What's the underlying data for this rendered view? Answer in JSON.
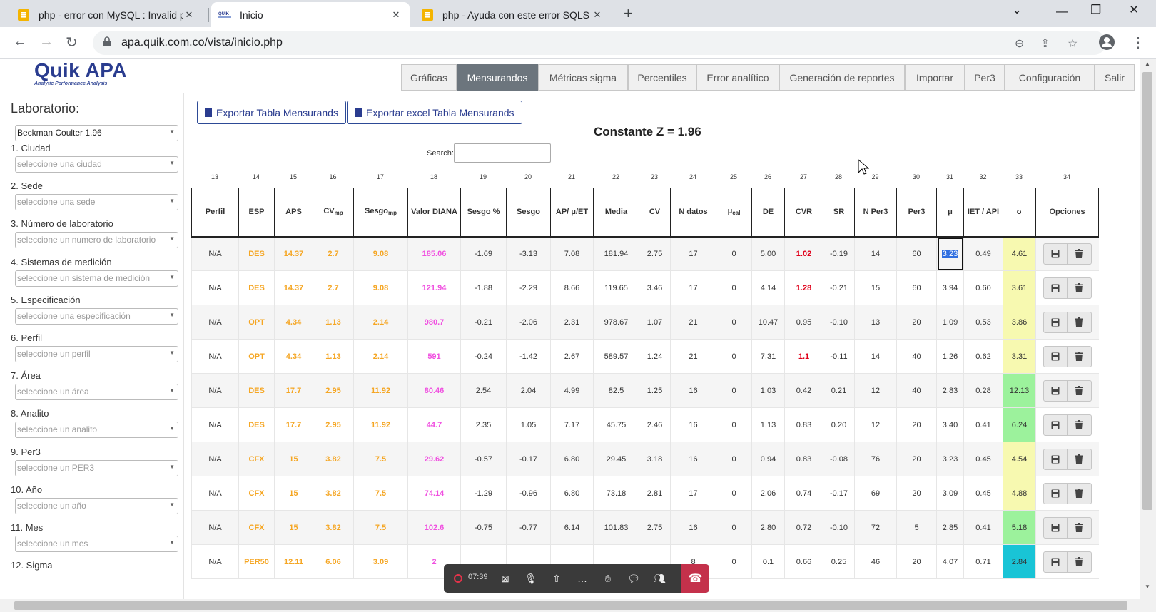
{
  "browser": {
    "tabs": [
      {
        "title": "php - error con MySQL : Invalid p",
        "active": false
      },
      {
        "title": "Inicio",
        "active": true
      },
      {
        "title": "php - Ayuda con este error SQLS",
        "active": false
      }
    ],
    "url": "apa.quik.com.co/vista/inicio.php"
  },
  "app": {
    "logo": "Quik APA",
    "logo_sub": "Analytic Performance Analysis",
    "nav": [
      "Gráficas",
      "Mensurandos",
      "Métricas sigma",
      "Percentiles",
      "Error analítico",
      "Generación de reportes",
      "Importar",
      "Per3",
      "Configuración",
      "Salir"
    ],
    "active_nav": "Mensurandos"
  },
  "sidebar": {
    "title": "Laboratorio:",
    "lab_value": "Beckman Coulter 1.96",
    "filters": [
      {
        "label": "1. Ciudad",
        "placeholder": "seleccione una ciudad"
      },
      {
        "label": "2. Sede",
        "placeholder": "seleccione una sede"
      },
      {
        "label": "3. Número de laboratorio",
        "placeholder": "seleccione un numero de laboratorio"
      },
      {
        "label": "4. Sistemas de medición",
        "placeholder": "seleccione un sistema de medición"
      },
      {
        "label": "5. Especificación",
        "placeholder": "seleccione una especificación"
      },
      {
        "label": "6. Perfil",
        "placeholder": "seleccione un perfil"
      },
      {
        "label": "7. Área",
        "placeholder": "seleccione un área"
      },
      {
        "label": "8. Analito",
        "placeholder": "seleccione un analito"
      },
      {
        "label": "9. Per3",
        "placeholder": "seleccione un PER3"
      },
      {
        "label": "10. Año",
        "placeholder": "seleccione un año"
      },
      {
        "label": "11. Mes",
        "placeholder": "seleccione un mes"
      },
      {
        "label": "12. Sigma",
        "placeholder": ""
      }
    ]
  },
  "main": {
    "export_pdf": "Exportar Tabla Mensurands",
    "export_excel": "Exportar excel Tabla Mensurands",
    "constant": "Constante Z = 1.96",
    "search_label": "Search:",
    "column_numbers": [
      "13",
      "14",
      "15",
      "16",
      "17",
      "18",
      "19",
      "20",
      "21",
      "22",
      "23",
      "24",
      "25",
      "26",
      "27",
      "28",
      "29",
      "30",
      "31",
      "32",
      "33",
      "34"
    ],
    "headers": [
      "Perfil",
      "ESP",
      "APS",
      "CV",
      "Sesgo",
      "Valor DIANA",
      "Sesgo %",
      "Sesgo",
      "AP/ μ/ET",
      "Media",
      "CV",
      "N datos",
      "μ",
      "DE",
      "CVR",
      "SR",
      "N Per3",
      "Per3",
      "μ",
      "IET / API",
      "σ",
      "Opciones"
    ],
    "header_subs": {
      "CV_mp": "mp",
      "Sesgo_mp": "mp",
      "mu_cal": "cal"
    },
    "rows": [
      [
        "N/A",
        "DES",
        "14.37",
        "2.7",
        "9.08",
        "185.06",
        "-1.69",
        "-3.13",
        "7.08",
        "181.94",
        "2.75",
        "17",
        "0",
        "5.00",
        "1.02",
        "-0.19",
        "14",
        "60",
        "3.23",
        "0.49",
        "4.61"
      ],
      [
        "N/A",
        "DES",
        "14.37",
        "2.7",
        "9.08",
        "121.94",
        "-1.88",
        "-2.29",
        "8.66",
        "119.65",
        "3.46",
        "17",
        "0",
        "4.14",
        "1.28",
        "-0.21",
        "15",
        "60",
        "3.94",
        "0.60",
        "3.61"
      ],
      [
        "N/A",
        "OPT",
        "4.34",
        "1.13",
        "2.14",
        "980.7",
        "-0.21",
        "-2.06",
        "2.31",
        "978.67",
        "1.07",
        "21",
        "0",
        "10.47",
        "0.95",
        "-0.10",
        "13",
        "20",
        "1.09",
        "0.53",
        "3.86"
      ],
      [
        "N/A",
        "OPT",
        "4.34",
        "1.13",
        "2.14",
        "591",
        "-0.24",
        "-1.42",
        "2.67",
        "589.57",
        "1.24",
        "21",
        "0",
        "7.31",
        "1.1",
        "-0.11",
        "14",
        "40",
        "1.26",
        "0.62",
        "3.31"
      ],
      [
        "N/A",
        "DES",
        "17.7",
        "2.95",
        "11.92",
        "80.46",
        "2.54",
        "2.04",
        "4.99",
        "82.5",
        "1.25",
        "16",
        "0",
        "1.03",
        "0.42",
        "0.21",
        "12",
        "40",
        "2.83",
        "0.28",
        "12.13"
      ],
      [
        "N/A",
        "DES",
        "17.7",
        "2.95",
        "11.92",
        "44.7",
        "2.35",
        "1.05",
        "7.17",
        "45.75",
        "2.46",
        "16",
        "0",
        "1.13",
        "0.83",
        "0.20",
        "12",
        "20",
        "3.40",
        "0.41",
        "6.24"
      ],
      [
        "N/A",
        "CFX",
        "15",
        "3.82",
        "7.5",
        "29.62",
        "-0.57",
        "-0.17",
        "6.80",
        "29.45",
        "3.18",
        "16",
        "0",
        "0.94",
        "0.83",
        "-0.08",
        "76",
        "20",
        "3.23",
        "0.45",
        "4.54"
      ],
      [
        "N/A",
        "CFX",
        "15",
        "3.82",
        "7.5",
        "74.14",
        "-1.29",
        "-0.96",
        "6.80",
        "73.18",
        "2.81",
        "17",
        "0",
        "2.06",
        "0.74",
        "-0.17",
        "69",
        "20",
        "3.09",
        "0.45",
        "4.88"
      ],
      [
        "N/A",
        "CFX",
        "15",
        "3.82",
        "7.5",
        "102.6",
        "-0.75",
        "-0.77",
        "6.14",
        "101.83",
        "2.75",
        "16",
        "0",
        "2.80",
        "0.72",
        "-0.10",
        "72",
        "5",
        "2.85",
        "0.41",
        "5.18"
      ],
      [
        "N/A",
        "PER50",
        "12.11",
        "6.06",
        "3.09",
        "2",
        "",
        "",
        "",
        "",
        "",
        "8",
        "0",
        "0.1",
        "0.66",
        "0.25",
        "46",
        "20",
        "4.07",
        "0.71",
        "2.84"
      ]
    ],
    "cvr_red_rows": [
      0,
      1,
      3
    ],
    "sigma_colors": [
      "#f7f9b0",
      "#f7f9b0",
      "#f7f9b0",
      "#f7f9b0",
      "#9cf29c",
      "#9cf29c",
      "#f7f9b0",
      "#f7f9b0",
      "#9cf29c",
      "#19c4d6"
    ]
  },
  "meeting": {
    "time": "07:39"
  },
  "colors": {
    "accent": "#2a3c8f",
    "orange": "#f5a623",
    "pink": "#f050e0",
    "red": "#e0001a"
  }
}
